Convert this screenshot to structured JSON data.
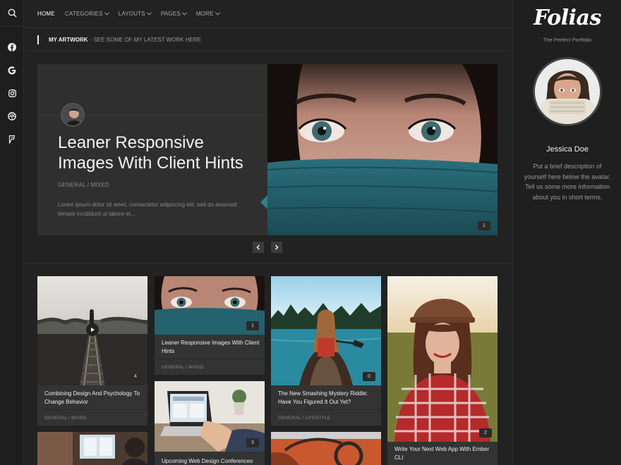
{
  "nav": {
    "items": [
      {
        "label": "HOME",
        "active": true,
        "dropdown": false
      },
      {
        "label": "CATEGORIES",
        "active": false,
        "dropdown": true
      },
      {
        "label": "LAYOUTS",
        "active": false,
        "dropdown": true
      },
      {
        "label": "PAGES",
        "active": false,
        "dropdown": true
      },
      {
        "label": "MORE",
        "active": false,
        "dropdown": true
      }
    ]
  },
  "rail": {
    "icons": [
      "search-icon",
      "facebook-icon",
      "google-icon",
      "instagram-icon",
      "dribbble-icon",
      "foursquare-icon"
    ]
  },
  "breadcrumb": {
    "title": "MY ARTWORK",
    "subtitle": "- SEE SOME OF MY LATEST WORK HERE"
  },
  "featured": {
    "title": "Leaner Responsive Images With Client Hints",
    "meta": "GENERAL / MIXED",
    "excerpt": "Lorem ipsum dolor sit amet, consectetur adipiscing elit, sed do eiusmod tempor incididunt ut labore et...",
    "badge": "1"
  },
  "cards": [
    {
      "title": "Combining Design And Psychology To Change Behavior",
      "meta": "GENERAL / MIXED",
      "badge": "4",
      "icon": "play-icon"
    },
    {
      "title": "Leaner Responsive Images With Client Hints",
      "meta": "GENERAL / MIXED",
      "badge": "1"
    },
    {
      "title": "The New Smashing Mystery Riddle: Have You Figured It Out Yet?",
      "meta": "GENERAL / LIFESTYLE",
      "badge": "0"
    },
    {
      "title": "Write Your Next Web App With Ember CLI",
      "meta": "",
      "badge": "2"
    },
    {
      "title": "Upcoming Web Design Conferences",
      "meta": "",
      "badge": "3"
    }
  ],
  "sidebar": {
    "logo": "Folias",
    "tagline": "The Perfect Portfolio",
    "name": "Jessica Doe",
    "bio": "Put a brief description of yourself here below the avatar. Tell us some more information about you in short terms."
  },
  "colors": {
    "background": "#222222",
    "panel": "#2f2f2f",
    "card": "#333333",
    "accent_teal": "#2f7f8c"
  }
}
